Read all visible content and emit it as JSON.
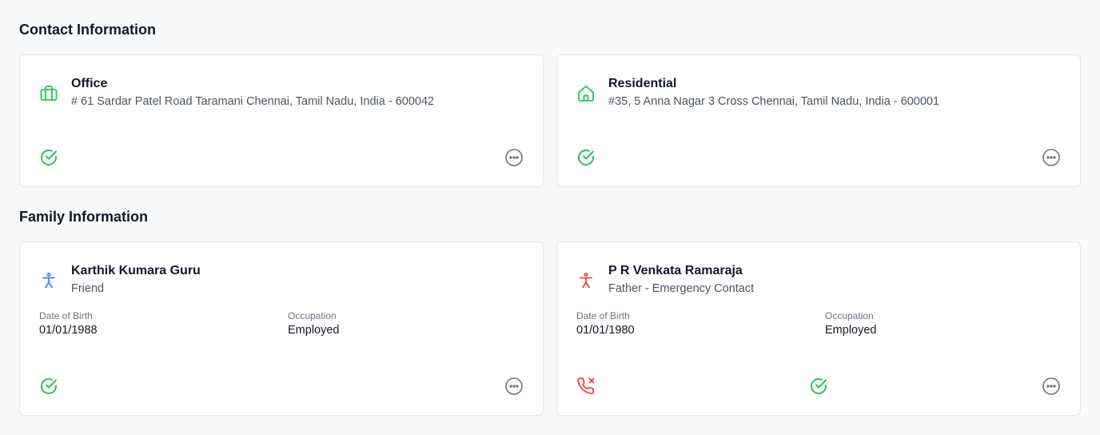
{
  "contact": {
    "title": "Contact Information",
    "cards": [
      {
        "title": "Office",
        "address": "# 61 Sardar Patel Road Taramani Chennai, Tamil Nadu, India - 600042",
        "icon": "briefcase-icon",
        "verified": true
      },
      {
        "title": "Residential",
        "address": "#35, 5 Anna Nagar 3 Cross Chennai, Tamil Nadu, India - 600001",
        "icon": "home-icon",
        "verified": true
      }
    ]
  },
  "family": {
    "title": "Family Information",
    "dob_label": "Date of Birth",
    "occupation_label": "Occupation",
    "members": [
      {
        "name": "Karthik Kumara Guru",
        "relation": "Friend",
        "dob": "01/01/1988",
        "occupation": "Employed",
        "icon": "person-icon",
        "icon_color": "#3b82f6",
        "verified": true
      },
      {
        "name": "P R Venkata Ramaraja",
        "relation": "Father - Emergency Contact",
        "dob": "01/01/1980",
        "occupation": "Employed",
        "icon": "person-icon",
        "icon_color": "#ef4444",
        "call_status": "phone-missed-icon",
        "verified": true
      }
    ]
  },
  "colors": {
    "accent_green": "#22c55e",
    "danger_red": "#ef4444",
    "muted_gray": "#6b7280"
  }
}
